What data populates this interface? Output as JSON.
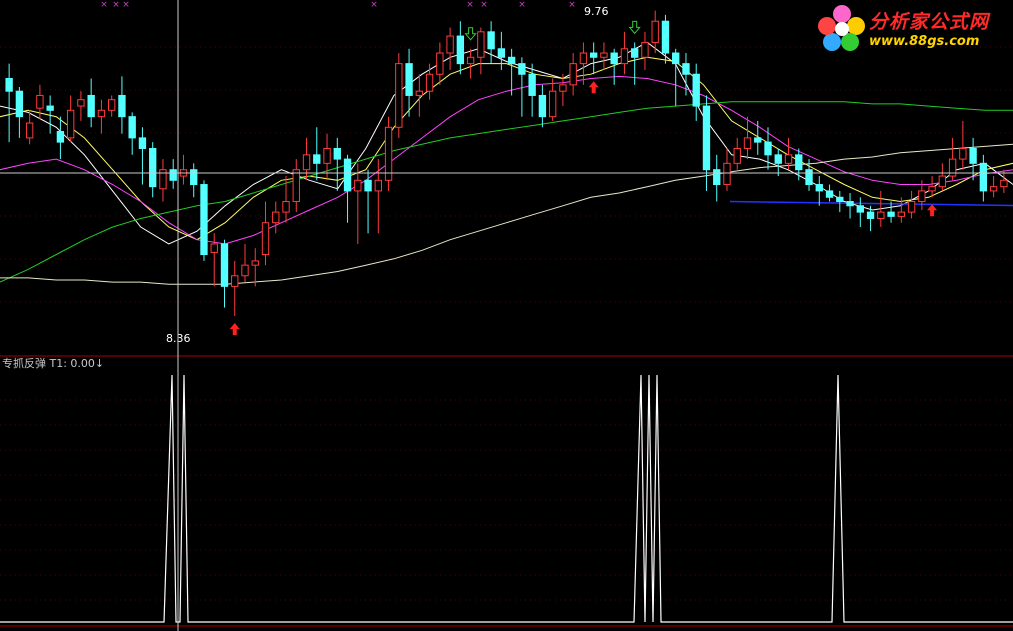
{
  "price_panel": {
    "high_label": "9.76",
    "low_label": "8.36"
  },
  "indicator_panel": {
    "name": "专抓反弹",
    "t1_label": "T1: 0.00",
    "t1_arrow": "↓"
  },
  "watermark": {
    "title": "分析家公式网",
    "url": "www.88gs.com"
  },
  "colors": {
    "background": "#000000",
    "up_candle": "#ff3b3b",
    "down_candle": "#54ffff",
    "ma_short": "#ffffff",
    "ma_mid": "#ffff66",
    "ma_long": "#ff44ff",
    "ma_60": "#22cc22",
    "ma_120": "#e8e8c8",
    "support_line": "#2233ff",
    "buy_arrow": "#ff2020",
    "sell_arrow": "#33cc33",
    "indicator_line": "#ffffff",
    "divider": "#aa0000"
  },
  "chart_data": [
    {
      "type": "candlestick",
      "panel": "price",
      "ylim": [
        8.2,
        9.85
      ],
      "labels": {
        "high": 9.76,
        "low": 8.36
      },
      "candles": [
        [
          9.48,
          9.42,
          9.55,
          9.18
        ],
        [
          9.42,
          9.3,
          9.44,
          9.2
        ],
        [
          9.2,
          9.27,
          9.33,
          9.17
        ],
        [
          9.34,
          9.4,
          9.45,
          9.29
        ],
        [
          9.35,
          9.33,
          9.4,
          9.22
        ],
        [
          9.23,
          9.18,
          9.3,
          9.1
        ],
        [
          9.2,
          9.33,
          9.4,
          9.18
        ],
        [
          9.35,
          9.38,
          9.42,
          9.28
        ],
        [
          9.4,
          9.3,
          9.48,
          9.25
        ],
        [
          9.3,
          9.33,
          9.38,
          9.22
        ],
        [
          9.33,
          9.38,
          9.4,
          9.3
        ],
        [
          9.4,
          9.3,
          9.49,
          9.22
        ],
        [
          9.3,
          9.2,
          9.32,
          9.12
        ],
        [
          9.2,
          9.15,
          9.25,
          8.98
        ],
        [
          9.15,
          8.97,
          9.18,
          8.92
        ],
        [
          8.96,
          9.05,
          9.1,
          8.9
        ],
        [
          9.05,
          9.0,
          9.1,
          8.96
        ],
        [
          9.02,
          9.05,
          9.12,
          8.98
        ],
        [
          9.05,
          8.98,
          9.08,
          8.92
        ],
        [
          8.98,
          8.65,
          9.0,
          8.62
        ],
        [
          8.66,
          8.7,
          8.75,
          8.5
        ],
        [
          8.7,
          8.5,
          8.72,
          8.4
        ],
        [
          8.5,
          8.55,
          8.62,
          8.36
        ],
        [
          8.55,
          8.6,
          8.7,
          8.52
        ],
        [
          8.6,
          8.62,
          8.68,
          8.5
        ],
        [
          8.65,
          8.8,
          8.9,
          8.6
        ],
        [
          8.8,
          8.85,
          8.9,
          8.75
        ],
        [
          8.85,
          8.9,
          9.02,
          8.8
        ],
        [
          8.9,
          9.05,
          9.1,
          8.85
        ],
        [
          9.05,
          9.12,
          9.2,
          9.0
        ],
        [
          9.12,
          9.08,
          9.25,
          9.0
        ],
        [
          9.08,
          9.15,
          9.22,
          9.0
        ],
        [
          9.15,
          9.1,
          9.2,
          8.95
        ],
        [
          9.1,
          8.95,
          9.12,
          8.8
        ],
        [
          8.95,
          9.0,
          9.08,
          8.7
        ],
        [
          9.0,
          8.95,
          9.05,
          8.75
        ],
        [
          8.95,
          9.0,
          9.1,
          8.75
        ],
        [
          9.0,
          9.25,
          9.3,
          8.95
        ],
        [
          9.25,
          9.55,
          9.6,
          9.2
        ],
        [
          9.55,
          9.4,
          9.62,
          9.3
        ],
        [
          9.4,
          9.42,
          9.5,
          9.3
        ],
        [
          9.42,
          9.5,
          9.55,
          9.38
        ],
        [
          9.5,
          9.6,
          9.65,
          9.45
        ],
        [
          9.6,
          9.68,
          9.72,
          9.52
        ],
        [
          9.68,
          9.55,
          9.75,
          9.5
        ],
        [
          9.55,
          9.58,
          9.62,
          9.48
        ],
        [
          9.58,
          9.7,
          9.72,
          9.5
        ],
        [
          9.7,
          9.62,
          9.75,
          9.55
        ],
        [
          9.62,
          9.58,
          9.7,
          9.52
        ],
        [
          9.58,
          9.55,
          9.62,
          9.4
        ],
        [
          9.55,
          9.5,
          9.58,
          9.3
        ],
        [
          9.5,
          9.4,
          9.55,
          9.3
        ],
        [
          9.4,
          9.3,
          9.45,
          9.25
        ],
        [
          9.3,
          9.42,
          9.48,
          9.28
        ],
        [
          9.42,
          9.45,
          9.5,
          9.35
        ],
        [
          9.45,
          9.55,
          9.6,
          9.4
        ],
        [
          9.55,
          9.6,
          9.65,
          9.45
        ],
        [
          9.6,
          9.58,
          9.65,
          9.5
        ],
        [
          9.58,
          9.6,
          9.65,
          9.52
        ],
        [
          9.6,
          9.55,
          9.62,
          9.45
        ],
        [
          9.55,
          9.62,
          9.7,
          9.5
        ],
        [
          9.62,
          9.58,
          9.65,
          9.45
        ],
        [
          9.58,
          9.65,
          9.7,
          9.52
        ],
        [
          9.65,
          9.75,
          9.8,
          9.6
        ],
        [
          9.75,
          9.6,
          9.78,
          9.55
        ],
        [
          9.6,
          9.55,
          9.62,
          9.35
        ],
        [
          9.55,
          9.5,
          9.6,
          9.4
        ],
        [
          9.5,
          9.35,
          9.55,
          9.28
        ],
        [
          9.35,
          9.05,
          9.4,
          8.95
        ],
        [
          9.05,
          8.98,
          9.12,
          8.9
        ],
        [
          8.98,
          9.08,
          9.15,
          8.95
        ],
        [
          9.08,
          9.15,
          9.2,
          9.05
        ],
        [
          9.15,
          9.2,
          9.3,
          9.1
        ],
        [
          9.2,
          9.18,
          9.28,
          9.12
        ],
        [
          9.18,
          9.12,
          9.25,
          9.05
        ],
        [
          9.12,
          9.08,
          9.15,
          9.02
        ],
        [
          9.08,
          9.12,
          9.2,
          9.05
        ],
        [
          9.12,
          9.05,
          9.15,
          9.0
        ],
        [
          9.05,
          8.98,
          9.1,
          8.95
        ],
        [
          8.98,
          8.95,
          9.02,
          8.88
        ],
        [
          8.95,
          8.92,
          8.98,
          8.9
        ],
        [
          8.92,
          8.9,
          8.95,
          8.85
        ],
        [
          8.9,
          8.88,
          8.94,
          8.82
        ],
        [
          8.88,
          8.85,
          8.92,
          8.78
        ],
        [
          8.85,
          8.82,
          8.88,
          8.76
        ],
        [
          8.82,
          8.85,
          8.95,
          8.78
        ],
        [
          8.85,
          8.83,
          8.9,
          8.8
        ],
        [
          8.83,
          8.85,
          8.92,
          8.8
        ],
        [
          8.85,
          8.9,
          8.95,
          8.82
        ],
        [
          8.9,
          8.95,
          9.0,
          8.86
        ],
        [
          8.95,
          8.97,
          9.02,
          8.92
        ],
        [
          8.97,
          9.02,
          9.08,
          8.95
        ],
        [
          9.02,
          9.1,
          9.2,
          9.0
        ],
        [
          9.1,
          9.15,
          9.28,
          9.05
        ],
        [
          9.15,
          9.08,
          9.2,
          9.0
        ],
        [
          9.08,
          8.95,
          9.12,
          8.9
        ],
        [
          8.95,
          8.97,
          9.02,
          8.92
        ],
        [
          8.97,
          9.0,
          9.05,
          8.94
        ]
      ],
      "moving_averages": [
        {
          "color": "#ffffff",
          "values": [
            9.35,
            9.32,
            9.25,
            9.12,
            8.95,
            8.78,
            8.7,
            8.76,
            8.88,
            8.98,
            9.05,
            9.0,
            8.96,
            9.15,
            9.4,
            9.5,
            9.58,
            9.62,
            9.56,
            9.52,
            9.48,
            9.55,
            9.58,
            9.65,
            9.55,
            9.3,
            9.12,
            9.1,
            9.05,
            8.98,
            8.9,
            8.86,
            8.88,
            8.95,
            9.05,
            9.08,
            8.98
          ]
        },
        {
          "color": "#ffff66",
          "values": [
            9.3,
            9.33,
            9.3,
            9.2,
            9.05,
            8.9,
            8.78,
            8.72,
            8.8,
            8.92,
            9.0,
            9.02,
            9.0,
            9.05,
            9.25,
            9.4,
            9.5,
            9.55,
            9.55,
            9.5,
            9.48,
            9.5,
            9.55,
            9.58,
            9.56,
            9.45,
            9.28,
            9.2,
            9.12,
            9.05,
            8.98,
            8.92,
            8.9,
            8.92,
            8.98,
            9.05,
            9.08
          ]
        },
        {
          "color": "#ff44ff",
          "values": [
            9.05,
            9.08,
            9.1,
            9.05,
            8.98,
            8.9,
            8.8,
            8.72,
            8.7,
            8.74,
            8.8,
            8.86,
            8.92,
            9.0,
            9.1,
            9.2,
            9.3,
            9.38,
            9.42,
            9.45,
            9.46,
            9.48,
            9.49,
            9.48,
            9.45,
            9.4,
            9.33,
            9.25,
            9.16,
            9.1,
            9.04,
            9.0,
            8.98,
            8.98,
            9.0,
            9.03,
            9.05
          ]
        },
        {
          "color": "#22cc22",
          "values": [
            8.52,
            8.58,
            8.65,
            8.72,
            8.78,
            8.82,
            8.85,
            8.88,
            8.9,
            8.94,
            8.98,
            9.02,
            9.06,
            9.1,
            9.14,
            9.17,
            9.2,
            9.22,
            9.24,
            9.26,
            9.28,
            9.3,
            9.32,
            9.34,
            9.35,
            9.36,
            9.37,
            9.37,
            9.37,
            9.37,
            9.37,
            9.36,
            9.36,
            9.35,
            9.34,
            9.33,
            9.33
          ]
        },
        {
          "color": "#e8e8c8",
          "values": [
            8.54,
            8.54,
            8.53,
            8.53,
            8.52,
            8.52,
            8.51,
            8.51,
            8.51,
            8.52,
            8.53,
            8.55,
            8.57,
            8.6,
            8.63,
            8.67,
            8.72,
            8.76,
            8.8,
            8.84,
            8.88,
            8.92,
            8.94,
            8.97,
            9.0,
            9.02,
            9.04,
            9.06,
            9.07,
            9.08,
            9.1,
            9.11,
            9.13,
            9.14,
            9.15,
            9.16,
            9.17
          ]
        }
      ],
      "support_value": 8.9,
      "buy_signals": [
        22,
        57,
        90
      ],
      "sell_signals": [
        45,
        61
      ]
    },
    {
      "type": "line",
      "panel": "indicator",
      "name": "专抓反弹",
      "ylim": [
        0,
        1
      ],
      "x": [
        0,
        160,
        164,
        172,
        176,
        180,
        184,
        188,
        192,
        196,
        200,
        204,
        208,
        630,
        634,
        641,
        645,
        649,
        653,
        657,
        661,
        665,
        669,
        828,
        832,
        838,
        844,
        848,
        1013
      ],
      "values": [
        0,
        0,
        0,
        1,
        0,
        0,
        1,
        0,
        0,
        0,
        0,
        0,
        0,
        0,
        0,
        1,
        0,
        1,
        0,
        1,
        0,
        0,
        0,
        0,
        0,
        1,
        0,
        0,
        0
      ]
    }
  ]
}
